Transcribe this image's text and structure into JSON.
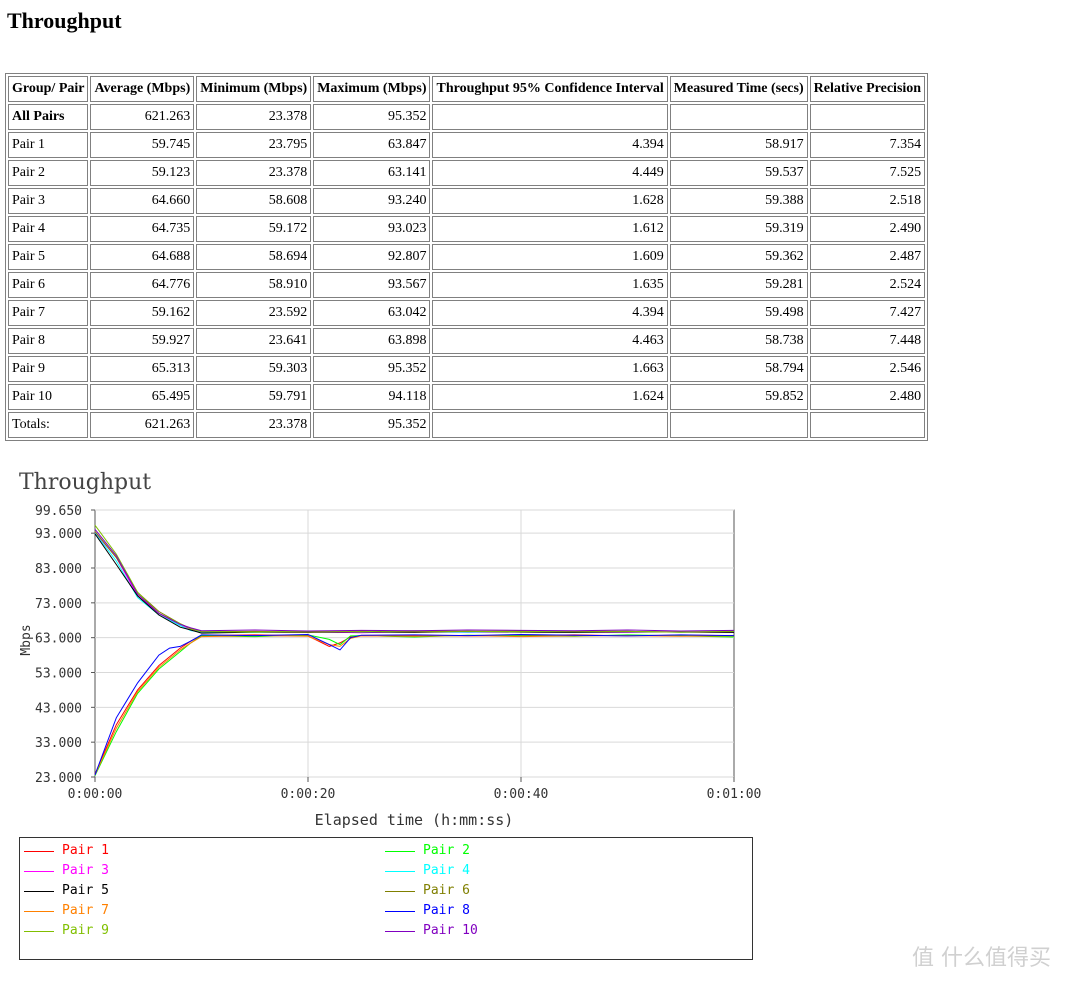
{
  "page": {
    "title": "Throughput"
  },
  "table": {
    "headers": [
      "Group/ Pair",
      "Average (Mbps)",
      "Minimum (Mbps)",
      "Maximum (Mbps)",
      "Throughput 95% Confidence Interval",
      "Measured Time (secs)",
      "Relative Precision"
    ],
    "rows": [
      [
        "All Pairs",
        "621.263",
        "23.378",
        "95.352",
        "",
        "",
        ""
      ],
      [
        "Pair 1",
        "59.745",
        "23.795",
        "63.847",
        "4.394",
        "58.917",
        "7.354"
      ],
      [
        "Pair 2",
        "59.123",
        "23.378",
        "63.141",
        "4.449",
        "59.537",
        "7.525"
      ],
      [
        "Pair 3",
        "64.660",
        "58.608",
        "93.240",
        "1.628",
        "59.388",
        "2.518"
      ],
      [
        "Pair 4",
        "64.735",
        "59.172",
        "93.023",
        "1.612",
        "59.319",
        "2.490"
      ],
      [
        "Pair 5",
        "64.688",
        "58.694",
        "92.807",
        "1.609",
        "59.362",
        "2.487"
      ],
      [
        "Pair 6",
        "64.776",
        "58.910",
        "93.567",
        "1.635",
        "59.281",
        "2.524"
      ],
      [
        "Pair 7",
        "59.162",
        "23.592",
        "63.042",
        "4.394",
        "59.498",
        "7.427"
      ],
      [
        "Pair 8",
        "59.927",
        "23.641",
        "63.898",
        "4.463",
        "58.738",
        "7.448"
      ],
      [
        "Pair 9",
        "65.313",
        "59.303",
        "95.352",
        "1.663",
        "58.794",
        "2.546"
      ],
      [
        "Pair 10",
        "65.495",
        "59.791",
        "94.118",
        "1.624",
        "59.852",
        "2.480"
      ],
      [
        "Totals:",
        "621.263",
        "23.378",
        "95.352",
        "",
        "",
        ""
      ]
    ]
  },
  "chart_data": {
    "type": "line",
    "title": "Throughput",
    "xlabel": "Elapsed time (h:mm:ss)",
    "ylabel": "Mbps",
    "xlim": [
      0,
      60
    ],
    "ylim": [
      23.0,
      99.65
    ],
    "yticks": [
      "23.000",
      "33.000",
      "43.000",
      "53.000",
      "63.000",
      "73.000",
      "83.000",
      "93.000",
      "99.650"
    ],
    "ytick_values": [
      23,
      33,
      43,
      53,
      63,
      73,
      83,
      93,
      99.65
    ],
    "xticks": [
      "0:00:00",
      "0:00:20",
      "0:00:40",
      "0:01:00"
    ],
    "xtick_values": [
      0,
      20,
      40,
      60
    ],
    "grid": true,
    "legend_position": "bottom",
    "series": [
      {
        "name": "Pair 1",
        "color": "#ff0000",
        "x": [
          0,
          2,
          4,
          6,
          8,
          9,
          10,
          15,
          20,
          22,
          23,
          24,
          25,
          30,
          35,
          40,
          45,
          50,
          55,
          60
        ],
        "y": [
          23.8,
          38,
          48,
          55,
          60,
          62,
          63.6,
          63.8,
          63.5,
          60.5,
          61.5,
          63.2,
          63.5,
          63.7,
          63.5,
          63.6,
          63.8,
          63.5,
          63.7,
          63.6
        ]
      },
      {
        "name": "Pair 2",
        "color": "#00ff00",
        "x": [
          0,
          2,
          4,
          6,
          8,
          9,
          10,
          15,
          20,
          22,
          23,
          24,
          25,
          30,
          35,
          40,
          45,
          50,
          55,
          60
        ],
        "y": [
          23.4,
          36,
          47,
          54,
          59,
          61.5,
          63.5,
          63.3,
          63.8,
          62.5,
          61,
          63.5,
          63.6,
          63.2,
          63.7,
          63.5,
          63.4,
          63.8,
          63.5,
          63.2
        ]
      },
      {
        "name": "Pair 3",
        "color": "#ff00ff",
        "x": [
          0,
          2,
          4,
          6,
          8,
          9,
          10,
          15,
          20,
          25,
          30,
          35,
          40,
          45,
          50,
          55,
          60
        ],
        "y": [
          93.2,
          86,
          75,
          70,
          66.5,
          65.5,
          64.5,
          64.8,
          64.7,
          64.4,
          64.8,
          64.5,
          64.7,
          64.6,
          64.5,
          64.8,
          64.6
        ]
      },
      {
        "name": "Pair 4",
        "color": "#00ffff",
        "x": [
          0,
          2,
          4,
          6,
          8,
          9,
          10,
          15,
          20,
          25,
          30,
          35,
          40,
          45,
          50,
          55,
          60
        ],
        "y": [
          93.0,
          85,
          74.5,
          69.5,
          66.5,
          65,
          64.6,
          64.5,
          64.8,
          64.6,
          64.7,
          64.6,
          64.8,
          64.5,
          64.7,
          64.6,
          64.7
        ]
      },
      {
        "name": "Pair 5",
        "color": "#000000",
        "x": [
          0,
          2,
          4,
          6,
          8,
          9,
          10,
          15,
          20,
          25,
          30,
          35,
          40,
          45,
          50,
          55,
          60
        ],
        "y": [
          92.8,
          84,
          75,
          69.5,
          66,
          65.2,
          64.3,
          64.6,
          64.5,
          64.7,
          64.5,
          64.8,
          64.6,
          64.5,
          64.7,
          64.6,
          64.5
        ]
      },
      {
        "name": "Pair 6",
        "color": "#808000",
        "x": [
          0,
          2,
          4,
          6,
          8,
          9,
          10,
          15,
          20,
          25,
          30,
          35,
          40,
          45,
          50,
          55,
          60
        ],
        "y": [
          93.5,
          86,
          76,
          70.5,
          67,
          65.6,
          64.7,
          64.8,
          64.6,
          64.9,
          64.7,
          64.8,
          64.9,
          64.7,
          64.8,
          64.6,
          64.8
        ]
      },
      {
        "name": "Pair 7",
        "color": "#ff8000",
        "x": [
          0,
          2,
          4,
          6,
          8,
          9,
          10,
          15,
          20,
          22,
          23,
          24,
          25,
          30,
          35,
          40,
          45,
          50,
          55,
          60
        ],
        "y": [
          23.6,
          37,
          47.5,
          54.5,
          59.5,
          61.5,
          63.3,
          63.6,
          63.4,
          61,
          60.5,
          62.8,
          63.5,
          63.4,
          63.6,
          63.3,
          63.5,
          63.6,
          63.4,
          63.5
        ]
      },
      {
        "name": "Pair 8",
        "color": "#0000ff",
        "x": [
          0,
          2,
          4,
          6,
          7,
          8,
          9,
          10,
          15,
          20,
          22,
          23,
          24,
          25,
          30,
          35,
          40,
          45,
          50,
          55,
          60
        ],
        "y": [
          23.6,
          40,
          50,
          58,
          60,
          60.5,
          62,
          63.8,
          63.6,
          63.9,
          61,
          59.5,
          63,
          63.7,
          63.8,
          63.6,
          63.9,
          63.7,
          63.5,
          63.8,
          63.6
        ]
      },
      {
        "name": "Pair 9",
        "color": "#80c000",
        "x": [
          0,
          2,
          4,
          6,
          8,
          9,
          10,
          15,
          20,
          25,
          30,
          35,
          40,
          45,
          50,
          55,
          60
        ],
        "y": [
          95.3,
          87,
          76,
          70,
          67,
          65.5,
          64.8,
          64.6,
          64.9,
          64.7,
          65,
          64.8,
          64.7,
          64.9,
          64.8,
          64.6,
          64.9
        ]
      },
      {
        "name": "Pair 10",
        "color": "#8000c0",
        "x": [
          0,
          2,
          4,
          6,
          8,
          9,
          10,
          15,
          20,
          25,
          30,
          35,
          40,
          45,
          50,
          55,
          60
        ],
        "y": [
          94.1,
          86.5,
          75.5,
          70,
          66.8,
          65.8,
          65,
          65.2,
          64.9,
          65.1,
          65,
          65.2,
          65.1,
          65,
          65.2,
          64.9,
          65.1
        ]
      }
    ]
  },
  "watermark": {
    "text": "值 什么值得买"
  }
}
